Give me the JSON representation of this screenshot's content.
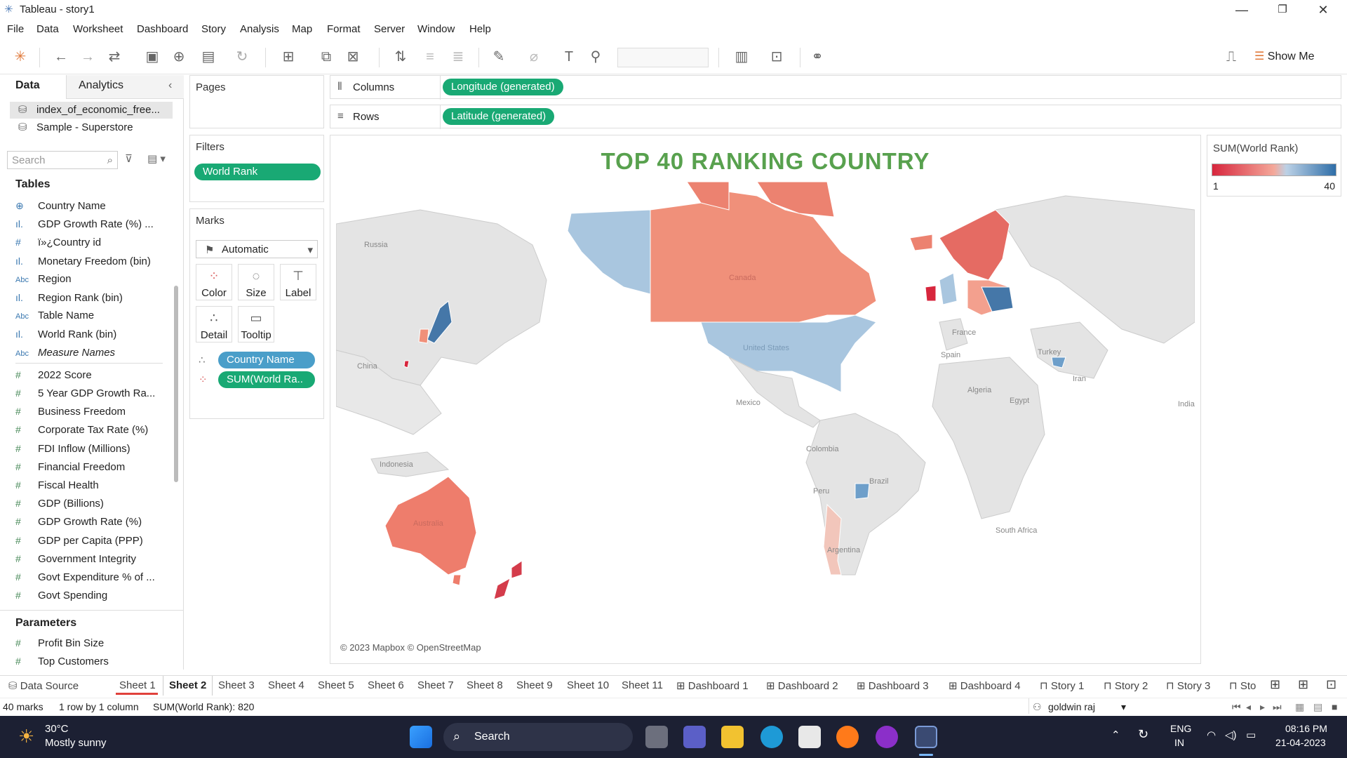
{
  "window": {
    "title": "Tableau - story1"
  },
  "menu": [
    "File",
    "Data",
    "Worksheet",
    "Dashboard",
    "Story",
    "Analysis",
    "Map",
    "Format",
    "Server",
    "Window",
    "Help"
  ],
  "toolbar": {
    "show_me": "Show Me"
  },
  "data_pane": {
    "tab_data": "Data",
    "tab_analytics": "Analytics",
    "sources": [
      "index_of_economic_free...",
      "Sample - Superstore"
    ],
    "search_placeholder": "Search",
    "tables_heading": "Tables",
    "fields": [
      {
        "icon": "globe-icon",
        "label": "Country Name"
      },
      {
        "icon": "bin-icon",
        "label": "GDP Growth Rate (%) ..."
      },
      {
        "icon": "hash-icon",
        "label": "ï»¿Country id"
      },
      {
        "icon": "bin-icon",
        "label": "Monetary Freedom (bin)"
      },
      {
        "icon": "abc-icon",
        "label": "Region"
      },
      {
        "icon": "bin-icon",
        "label": "Region Rank (bin)"
      },
      {
        "icon": "abc-icon",
        "label": "Table Name"
      },
      {
        "icon": "bin-icon",
        "label": "World Rank (bin)"
      },
      {
        "icon": "abc-icon",
        "label": "Measure Names"
      },
      {
        "icon": "hash-icon",
        "label": "2022 Score"
      },
      {
        "icon": "hash-icon",
        "label": "5 Year GDP Growth Ra..."
      },
      {
        "icon": "hash-icon",
        "label": "Business Freedom"
      },
      {
        "icon": "hash-icon",
        "label": "Corporate Tax Rate (%)"
      },
      {
        "icon": "hash-icon",
        "label": "FDI Inflow (Millions)"
      },
      {
        "icon": "hash-icon",
        "label": "Financial Freedom"
      },
      {
        "icon": "hash-icon",
        "label": "Fiscal Health"
      },
      {
        "icon": "hash-icon",
        "label": "GDP (Billions)"
      },
      {
        "icon": "hash-icon",
        "label": "GDP Growth Rate (%)"
      },
      {
        "icon": "hash-icon",
        "label": "GDP per Capita (PPP)"
      },
      {
        "icon": "hash-icon",
        "label": "Government Integrity"
      },
      {
        "icon": "hash-icon",
        "label": "Govt Expenditure % of ..."
      },
      {
        "icon": "hash-icon",
        "label": "Govt Spending"
      }
    ],
    "parameters_heading": "Parameters",
    "parameters": [
      "Profit Bin Size",
      "Top Customers"
    ]
  },
  "pages": {
    "label": "Pages"
  },
  "filters": {
    "label": "Filters",
    "pills": [
      "World Rank"
    ]
  },
  "marks": {
    "label": "Marks",
    "type": "Automatic",
    "buttons": [
      "Color",
      "Size",
      "Label",
      "Detail",
      "Tooltip"
    ],
    "pills": [
      "Country Name",
      "SUM(World Ra.."
    ]
  },
  "shelves": {
    "columns_label": "Columns",
    "columns_pill": "Longitude (generated)",
    "rows_label": "Rows",
    "rows_pill": "Latitude (generated)"
  },
  "viz": {
    "title": "TOP  40 RANKING COUNTRY",
    "attribution": "© 2023 Mapbox © OpenStreetMap",
    "map_labels": [
      "Russia",
      "China",
      "Indonesia",
      "Australia",
      "Canada",
      "United States",
      "Mexico",
      "Colombia",
      "Peru",
      "Brazil",
      "Argentina",
      "Spain",
      "France",
      "Turkey",
      "Algeria",
      "Egypt",
      "Iran",
      "India",
      "South Africa"
    ]
  },
  "legend": {
    "title": "SUM(World Rank)",
    "min": "1",
    "max": "40",
    "color_low": "#d7263d",
    "color_high": "#2f6ea8"
  },
  "sheet_tabs": [
    "Data Source",
    "Sheet 1",
    "Sheet 2",
    "Sheet 3",
    "Sheet 4",
    "Sheet 5",
    "Sheet 6",
    "Sheet 7",
    "Sheet 8",
    "Sheet 9",
    "Sheet 10",
    "Sheet 11",
    "Dashboard 1",
    "Dashboard 2",
    "Dashboard 3",
    "Dashboard 4",
    "Story 1",
    "Story 2",
    "Story 3",
    "Sto"
  ],
  "active_tab": "Sheet 2",
  "status": {
    "marks": "40 marks",
    "rows": "1 row by 1 column",
    "sum": "SUM(World Rank): 820",
    "user": "goldwin raj"
  },
  "taskbar": {
    "temp": "30°C",
    "weather": "Mostly sunny",
    "search": "Search",
    "lang1": "ENG",
    "lang2": "IN",
    "time": "08:16 PM",
    "date": "21-04-2023"
  }
}
